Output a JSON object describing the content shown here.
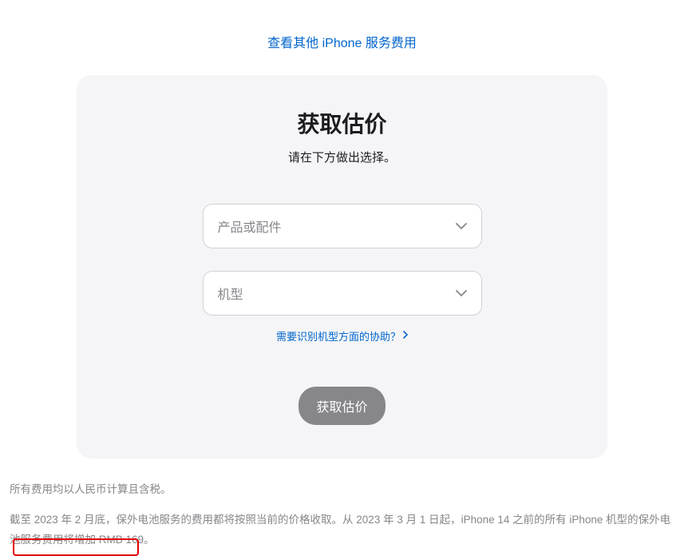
{
  "topLink": {
    "label": "查看其他 iPhone 服务费用"
  },
  "card": {
    "title": "获取估价",
    "subtitle": "请在下方做出选择。",
    "select1Label": "产品或配件",
    "select2Label": "机型",
    "helpLink": "需要识别机型方面的协助？",
    "submitLabel": "获取估价"
  },
  "footer": {
    "p1": "所有费用均以人民币计算且含税。",
    "p2": "截至 2023 年 2 月底，保外电池服务的费用都将按照当前的价格收取。从 2023 年 3 月 1 日起，iPhone 14 之前的所有 iPhone 机型的保外电池服务费用将增加 RMB 169。"
  }
}
